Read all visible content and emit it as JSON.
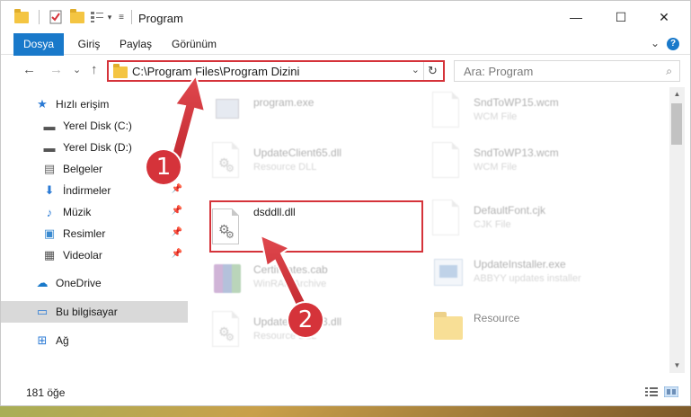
{
  "window": {
    "title": "Program"
  },
  "titlebar": {
    "minimize": "—",
    "maximize": "☐",
    "close": "✕"
  },
  "ribbon": {
    "tabs": [
      {
        "label": "Dosya",
        "active": true
      },
      {
        "label": "Giriş"
      },
      {
        "label": "Paylaş"
      },
      {
        "label": "Görünüm"
      }
    ],
    "expand_glyph": "⌄",
    "help_glyph": "?"
  },
  "nav": {
    "back": "←",
    "forward": "→",
    "recent": "⌄",
    "up": "↑",
    "address": "C:\\Program Files\\Program Dizini",
    "dropdown_glyph": "⌄",
    "refresh_glyph": "↻"
  },
  "search": {
    "placeholder": "Ara: Program",
    "icon": "⌕"
  },
  "sidebar": {
    "items": [
      {
        "label": "Hızlı erişim",
        "icon": "star-icon",
        "glyph": "★"
      },
      {
        "label": "Yerel Disk (C:)",
        "icon": "drive-icon",
        "glyph": "▬"
      },
      {
        "label": "Yerel Disk (D:)",
        "icon": "drive-icon",
        "glyph": "▬"
      },
      {
        "label": "Belgeler",
        "icon": "documents-icon",
        "glyph": "▤"
      },
      {
        "label": "İndirmeler",
        "icon": "download-icon",
        "glyph": "⬇"
      },
      {
        "label": "Müzik",
        "icon": "music-icon",
        "glyph": "♪"
      },
      {
        "label": "Resimler",
        "icon": "pictures-icon",
        "glyph": "▣"
      },
      {
        "label": "Videolar",
        "icon": "videos-icon",
        "glyph": "▦"
      },
      {
        "label": "OneDrive",
        "icon": "cloud-icon",
        "glyph": "☁"
      },
      {
        "label": "Bu bilgisayar",
        "icon": "computer-icon",
        "glyph": "▭"
      },
      {
        "label": "Ağ",
        "icon": "network-icon",
        "glyph": "⊞"
      }
    ],
    "pin_glyph": "📌"
  },
  "files": [
    {
      "name": "program.exe",
      "type": ""
    },
    {
      "name": "SndToWP15.wcm",
      "type": "WCM File"
    },
    {
      "name": "UpdateClient65.dll",
      "type": "Resource DLL"
    },
    {
      "name": "SndToWP13.wcm",
      "type": "WCM File"
    },
    {
      "name": "dsddll.dll",
      "type": ""
    },
    {
      "name": "DefaultFont.cjk",
      "type": "CJK File"
    },
    {
      "name": "Certificates.cab",
      "type": "WinRAR Archive"
    },
    {
      "name": "UpdateInstaller.exe",
      "type": "ABBYY updates installer"
    },
    {
      "name": "UpdateClient63.dll",
      "type": "Resource DLL"
    },
    {
      "name": "Resource",
      "type": ""
    }
  ],
  "status": {
    "count": "181 öğe"
  },
  "annotations": {
    "step1": "1",
    "step2": "2"
  },
  "colors": {
    "accent": "#1979ca",
    "highlight": "#d5333a"
  }
}
